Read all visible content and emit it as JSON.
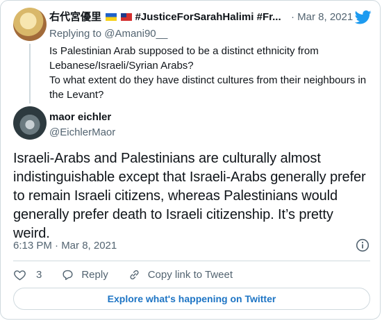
{
  "parent": {
    "display_name": "右代宮優里",
    "display_name_rest": "#JusticeForSarahHalimi #Fr...",
    "date": "· Mar 8, 2021",
    "replying_to_prefix": "Replying to ",
    "replying_to_handle": "@Amani90__",
    "text_line1": "Is Palestinian Arab supposed to be a distinct ethnicity from Lebanese/Israeli/Syrian Arabs?",
    "text_line2": "To what extent do they have distinct cultures from their neighbours in the Levant?"
  },
  "tweet": {
    "display_name": "maor eichler",
    "handle": "@EichlerMaor",
    "text": "Israeli-Arabs and Palestinians are culturally almost indistinguishable except that Israeli-Arabs generally prefer to remain Israeli citizens, whereas Palestinians would generally prefer death to Israeli citizenship. It’s pretty weird.",
    "timestamp": "6:13 PM · Mar 8, 2021",
    "like_count": "3",
    "reply_label": "Reply",
    "copy_link_label": "Copy link to Tweet"
  },
  "explore_button": "Explore what's happening on Twitter",
  "colors": {
    "accent": "#1d9bf0",
    "secondary_text": "#536471",
    "border": "#cfd9de"
  },
  "icons": [
    "twitter-bird-icon",
    "info-icon",
    "heart-icon",
    "reply-icon",
    "link-icon"
  ]
}
